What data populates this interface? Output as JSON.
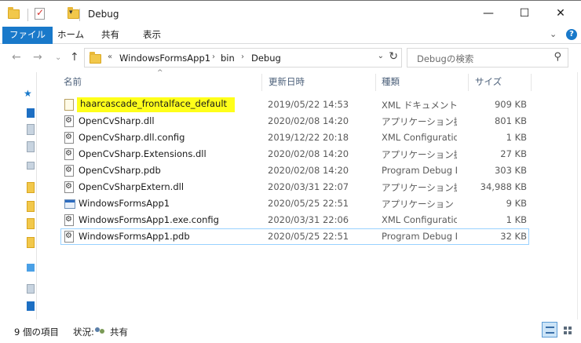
{
  "window": {
    "title": "Debug",
    "minimize_glyph": "—",
    "maximize_glyph": "☐",
    "close_glyph": "✕"
  },
  "ribbon": {
    "tabs": [
      "ファイル",
      "ホーム",
      "共有",
      "表示"
    ],
    "expand_glyph": "⌄",
    "help_glyph": "?"
  },
  "nav": {
    "back_glyph": "←",
    "forward_glyph": "→",
    "recent_glyph": "⌄",
    "up_glyph": "↑"
  },
  "address": {
    "overflow": "«",
    "crumbs": [
      "WindowsFormsApp1",
      "bin",
      "Debug"
    ],
    "separator": "›",
    "dropdown_glyph": "⌄",
    "refresh_glyph": "↻"
  },
  "search": {
    "placeholder": "Debugの検索",
    "icon_glyph": "⚲"
  },
  "columns": {
    "name": "名前",
    "modified": "更新日時",
    "type": "種類",
    "size": "サイズ",
    "sort_glyph": "^"
  },
  "files": [
    {
      "name": "haarcascade_frontalface_default",
      "modified": "2019/05/22 14:53",
      "type": "XML ドキュメント",
      "size": "909 KB",
      "icon": "xml-file-icon",
      "highlighted": true
    },
    {
      "name": "OpenCvSharp.dll",
      "modified": "2020/02/08 14:20",
      "type": "アプリケーション拡張",
      "size": "801 KB",
      "icon": "dll-file-icon"
    },
    {
      "name": "OpenCvSharp.dll.config",
      "modified": "2019/12/22 20:18",
      "type": "XML Configuratio...",
      "size": "1 KB",
      "icon": "config-file-icon"
    },
    {
      "name": "OpenCvSharp.Extensions.dll",
      "modified": "2020/02/08 14:20",
      "type": "アプリケーション拡張",
      "size": "27 KB",
      "icon": "dll-file-icon"
    },
    {
      "name": "OpenCvSharp.pdb",
      "modified": "2020/02/08 14:20",
      "type": "Program Debug D...",
      "size": "303 KB",
      "icon": "pdb-file-icon"
    },
    {
      "name": "OpenCvSharpExtern.dll",
      "modified": "2020/03/31 22:07",
      "type": "アプリケーション拡張",
      "size": "34,988 KB",
      "icon": "dll-file-icon"
    },
    {
      "name": "WindowsFormsApp1",
      "modified": "2020/05/25 22:51",
      "type": "アプリケーション",
      "size": "9 KB",
      "icon": "application-icon"
    },
    {
      "name": "WindowsFormsApp1.exe.config",
      "modified": "2020/03/31 22:06",
      "type": "XML Configuratio...",
      "size": "1 KB",
      "icon": "config-file-icon"
    },
    {
      "name": "WindowsFormsApp1.pdb",
      "modified": "2020/05/25 22:51",
      "type": "Program Debug D...",
      "size": "32 KB",
      "icon": "pdb-file-icon",
      "selected": true
    }
  ],
  "status": {
    "item_count": "9 個の項目",
    "state_label": "状況:",
    "share_label": "共有"
  },
  "colors": {
    "accent": "#1979ca",
    "highlight": "#ffff1a",
    "selection_border": "#99d1ff"
  }
}
